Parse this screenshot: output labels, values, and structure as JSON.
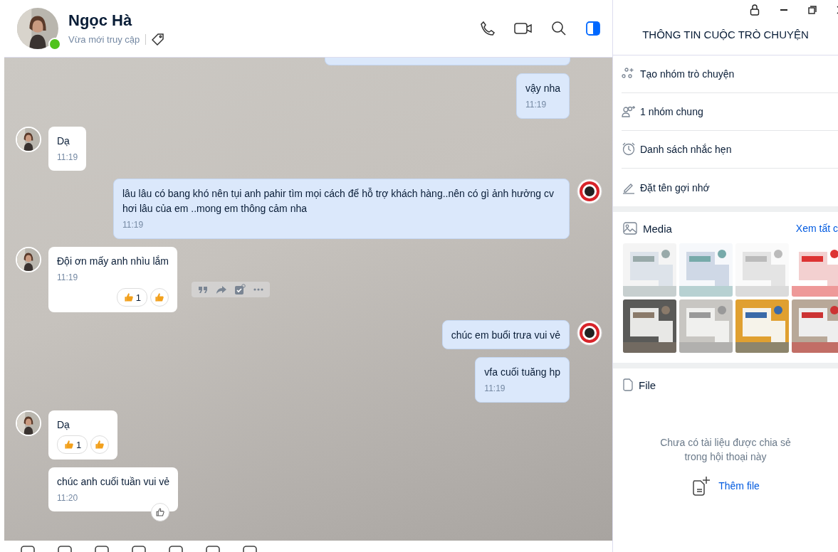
{
  "header": {
    "name": "Ngọc Hà",
    "status": "Vừa mới truy cập",
    "online": true
  },
  "messages": [
    {
      "kind": "me",
      "text": "vậy nha",
      "time": "11:19",
      "avatar": false
    },
    {
      "kind": "them",
      "text": "Dạ",
      "time": "11:19",
      "avatar": true
    },
    {
      "kind": "me",
      "text": "lâu lâu có bang khó nên tụi anh pahir tìm mọi cách để hỗ trợ khách hàng..nên có gì ảnh hưởng cv hơi lâu của em ..mong em thông cảm nha",
      "time": "11:19",
      "avatar": true
    },
    {
      "kind": "them",
      "text": "Đội ơn mấy anh nhìu lắm",
      "time": "11:19",
      "avatar": true,
      "reaction_count": "1",
      "show_actions": true
    },
    {
      "kind": "me",
      "text": "chúc em buổi trưa vui vẻ",
      "avatar": true
    },
    {
      "kind": "me",
      "text": "vfa cuối tuăng hp",
      "time": "11:19",
      "avatar": false
    },
    {
      "kind": "them",
      "text": "Dạ",
      "avatar": true,
      "reaction_count": "1"
    },
    {
      "kind": "them",
      "text": "chúc anh cuối tuần vui vẻ",
      "time": "11:20",
      "avatar": false,
      "like_button": true
    }
  ],
  "panel": {
    "title": "THÔNG TIN CUỘC TRÒ CHUYỆN",
    "items": [
      {
        "kind": "group",
        "label": "Tạo nhóm trò chuyện"
      },
      {
        "kind": "people",
        "label": "1 nhóm chung"
      },
      {
        "kind": "clock",
        "label": "Danh sách nhắc hẹn"
      },
      {
        "kind": "pen",
        "label": "Đặt tên gợi nhớ"
      }
    ],
    "media": {
      "title": "Media",
      "link": "Xem tất c"
    },
    "file": {
      "title": "File",
      "empty": "Chưa có tài liệu được chia sẻ trong hội thoại này",
      "add": "Thêm file"
    }
  }
}
